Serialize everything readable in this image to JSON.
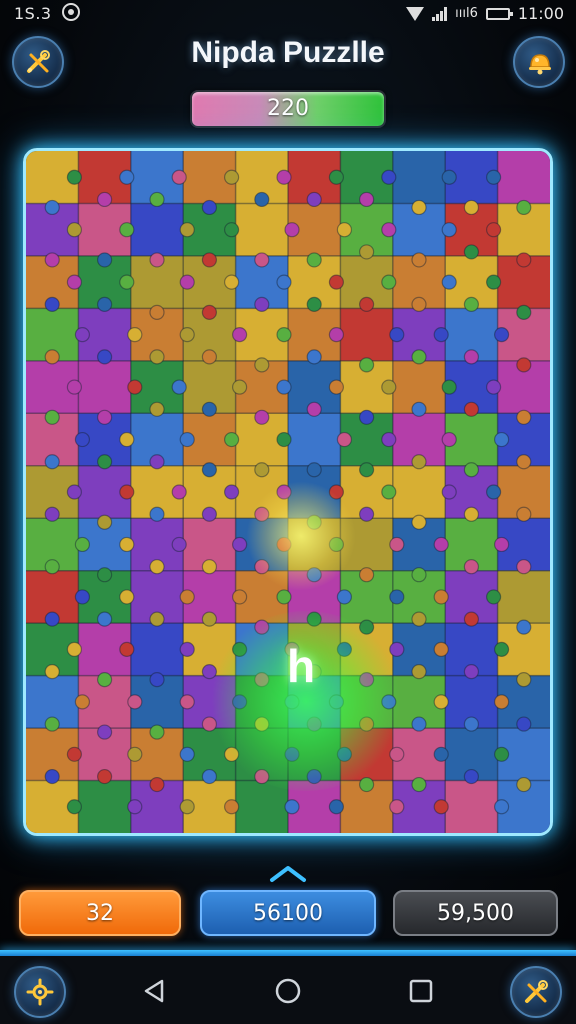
{
  "status_bar": {
    "time_left": "1S.3",
    "time_right": "11:00",
    "network_label": "ıııl6"
  },
  "header": {
    "title": "Nipda Puzzlle",
    "score": "220",
    "left_button_icon": "tools-icon",
    "right_button_icon": "hint-bell-icon"
  },
  "board": {
    "active_piece_label": "h"
  },
  "stats": {
    "left_value": "32",
    "center_value": "56100",
    "right_value": "59,500"
  },
  "bottom_nav": {
    "left_icon": "settings-sparkle-icon",
    "back_icon": "back-triangle-icon",
    "home_icon": "home-circle-icon",
    "recent_icon": "recent-square-icon",
    "right_icon": "tools-icon"
  },
  "colors": {
    "board_border": "#9fe9ff",
    "accent_blue": "#2fb4ff",
    "glow_green": "#3cff5a",
    "orange": "#f06a0a"
  }
}
